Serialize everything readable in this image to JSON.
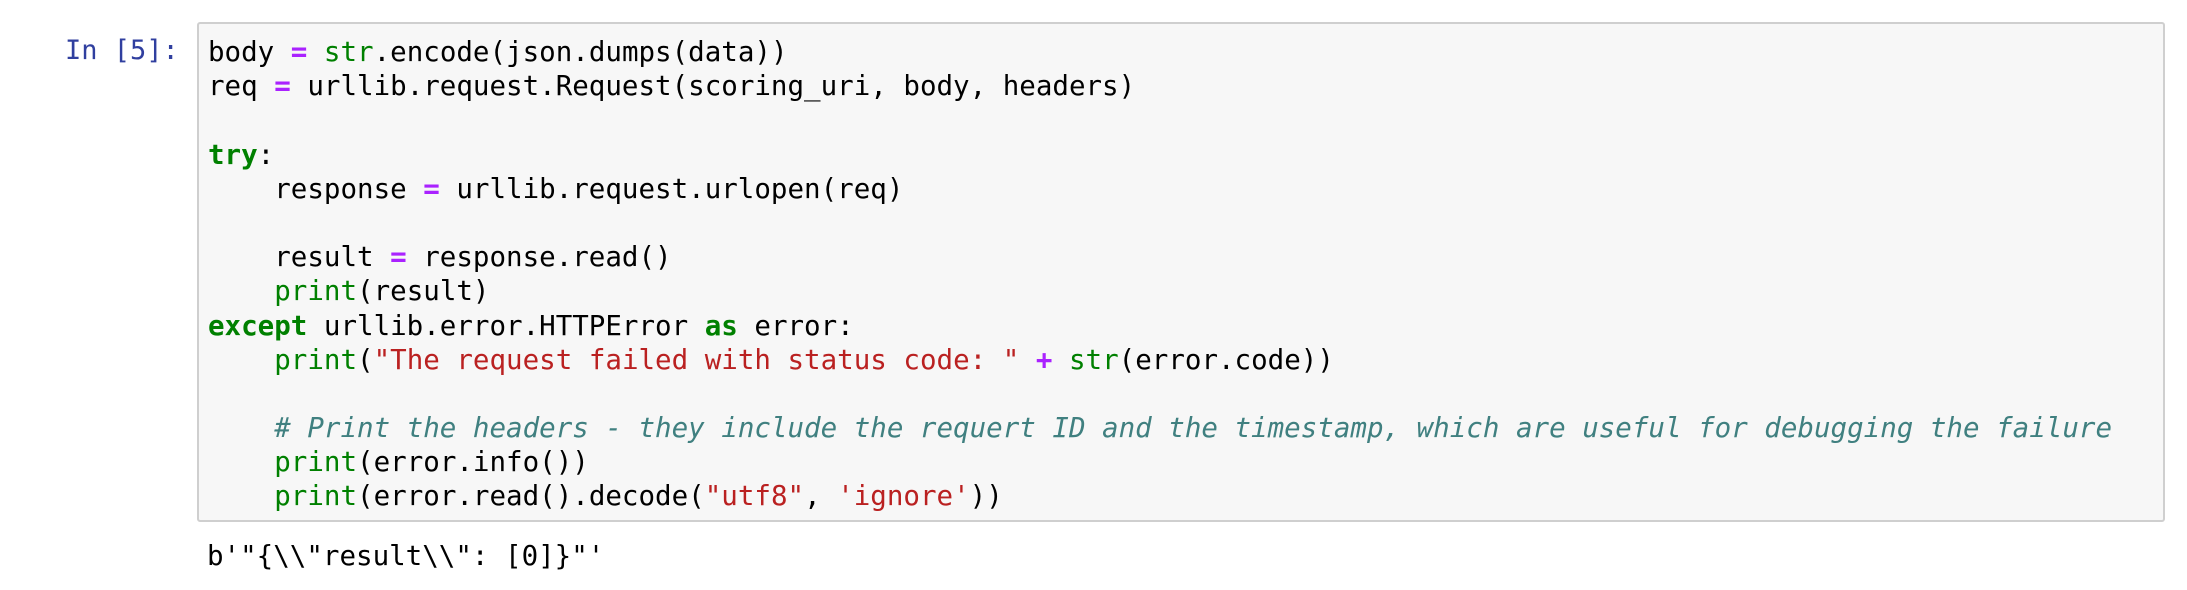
{
  "cell": {
    "prompt": "In [5]:",
    "lines": [
      [
        {
          "t": "body ",
          "c": ""
        },
        {
          "t": "=",
          "c": "op"
        },
        {
          "t": " ",
          "c": ""
        },
        {
          "t": "str",
          "c": "bi"
        },
        {
          "t": ".encode(json.dumps(data))",
          "c": ""
        }
      ],
      [
        {
          "t": "req ",
          "c": ""
        },
        {
          "t": "=",
          "c": "op"
        },
        {
          "t": " urllib.request.Request(scoring_uri, body, headers)",
          "c": ""
        }
      ],
      [],
      [
        {
          "t": "try",
          "c": "kw"
        },
        {
          "t": ":",
          "c": ""
        }
      ],
      [
        {
          "t": "    response ",
          "c": ""
        },
        {
          "t": "=",
          "c": "op"
        },
        {
          "t": " urllib.request.urlopen(req)",
          "c": ""
        }
      ],
      [],
      [
        {
          "t": "    result ",
          "c": ""
        },
        {
          "t": "=",
          "c": "op"
        },
        {
          "t": " response.read()",
          "c": ""
        }
      ],
      [
        {
          "t": "    ",
          "c": ""
        },
        {
          "t": "print",
          "c": "bi"
        },
        {
          "t": "(result)",
          "c": ""
        }
      ],
      [
        {
          "t": "except",
          "c": "kw"
        },
        {
          "t": " urllib.error.HTTPError ",
          "c": ""
        },
        {
          "t": "as",
          "c": "kw"
        },
        {
          "t": " error:",
          "c": ""
        }
      ],
      [
        {
          "t": "    ",
          "c": ""
        },
        {
          "t": "print",
          "c": "bi"
        },
        {
          "t": "(",
          "c": ""
        },
        {
          "t": "\"The request failed with status code: \"",
          "c": "str"
        },
        {
          "t": " ",
          "c": ""
        },
        {
          "t": "+",
          "c": "op"
        },
        {
          "t": " ",
          "c": ""
        },
        {
          "t": "str",
          "c": "bi"
        },
        {
          "t": "(error.code))",
          "c": ""
        }
      ],
      [],
      [
        {
          "t": "    ",
          "c": ""
        },
        {
          "t": "# Print the headers - they include the requert ID and the timestamp, which are useful for debugging the failure",
          "c": "cm"
        }
      ],
      [
        {
          "t": "    ",
          "c": ""
        },
        {
          "t": "print",
          "c": "bi"
        },
        {
          "t": "(error.info())",
          "c": ""
        }
      ],
      [
        {
          "t": "    ",
          "c": ""
        },
        {
          "t": "print",
          "c": "bi"
        },
        {
          "t": "(error.read().decode(",
          "c": ""
        },
        {
          "t": "\"utf8\"",
          "c": "str"
        },
        {
          "t": ", ",
          "c": ""
        },
        {
          "t": "'ignore'",
          "c": "str"
        },
        {
          "t": "))",
          "c": ""
        }
      ]
    ],
    "output": "b'\"{\\\\\"result\\\\\": [0]}\"'"
  },
  "colors": {
    "prompt": "#303F9F",
    "keyword": "#008000",
    "builtin": "#008000",
    "operator": "#AA22FF",
    "string": "#BA2121",
    "comment": "#408080",
    "input_bg": "#f7f7f7",
    "input_border": "#cfcfcf"
  }
}
